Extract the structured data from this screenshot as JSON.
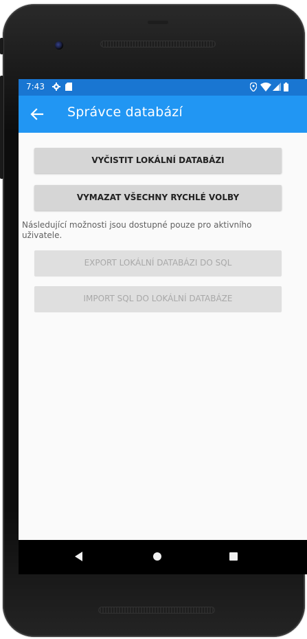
{
  "status_bar": {
    "time": "7:43",
    "icons": [
      "gear-icon",
      "sd-card-icon",
      "location-icon",
      "wifi-icon",
      "signal-icon",
      "battery-icon"
    ]
  },
  "app_bar": {
    "title": "Správce databází",
    "back_icon": "arrow-back-icon",
    "color": "#2196f3",
    "status_color": "#1976d2"
  },
  "main": {
    "buttons": [
      {
        "label": "VYČISTIT LOKÁLNÍ DATABÁZI",
        "enabled": true
      },
      {
        "label": "VYMAZAT VŠECHNY RYCHLÉ VOLBY",
        "enabled": true
      }
    ],
    "info_text": "Následující možnosti jsou dostupné pouze pro aktivního uživatele.",
    "user_buttons": [
      {
        "label": "EXPORT LOKÁLNÍ DATABÁZI DO SQL",
        "enabled": false
      },
      {
        "label": "IMPORT SQL DO LOKÁLNÍ DATABÁZE",
        "enabled": false
      }
    ]
  },
  "nav_bar": {
    "icons": [
      "nav-back-icon",
      "nav-home-icon",
      "nav-recent-icon"
    ]
  }
}
